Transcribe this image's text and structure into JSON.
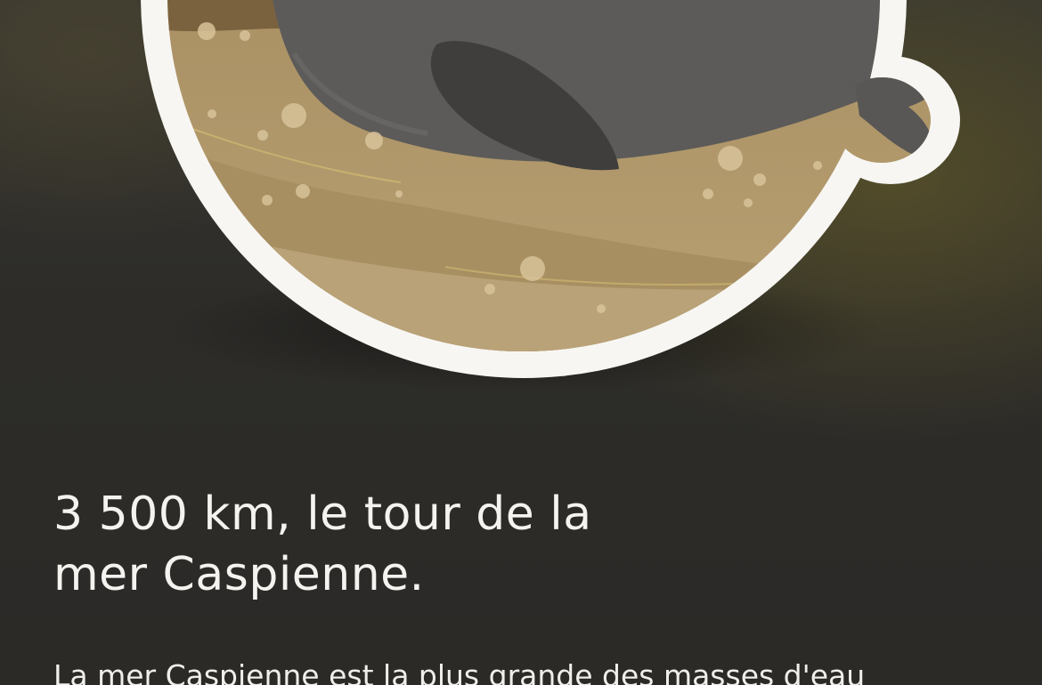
{
  "headline": {
    "line1": "3 500 km, le tour de la",
    "line2": "mer Caspienne."
  },
  "body": {
    "text": "La mer Caspienne est la plus grande des masses d'eau"
  },
  "badge": {
    "icon": "caspian-seal-illustration-icon",
    "colors": {
      "ring": "#f7f6f3",
      "sand_light": "#b59c70",
      "sand_dark": "#8a7048",
      "seal": "#5b5a58",
      "seal_dark": "#3a3938"
    }
  }
}
